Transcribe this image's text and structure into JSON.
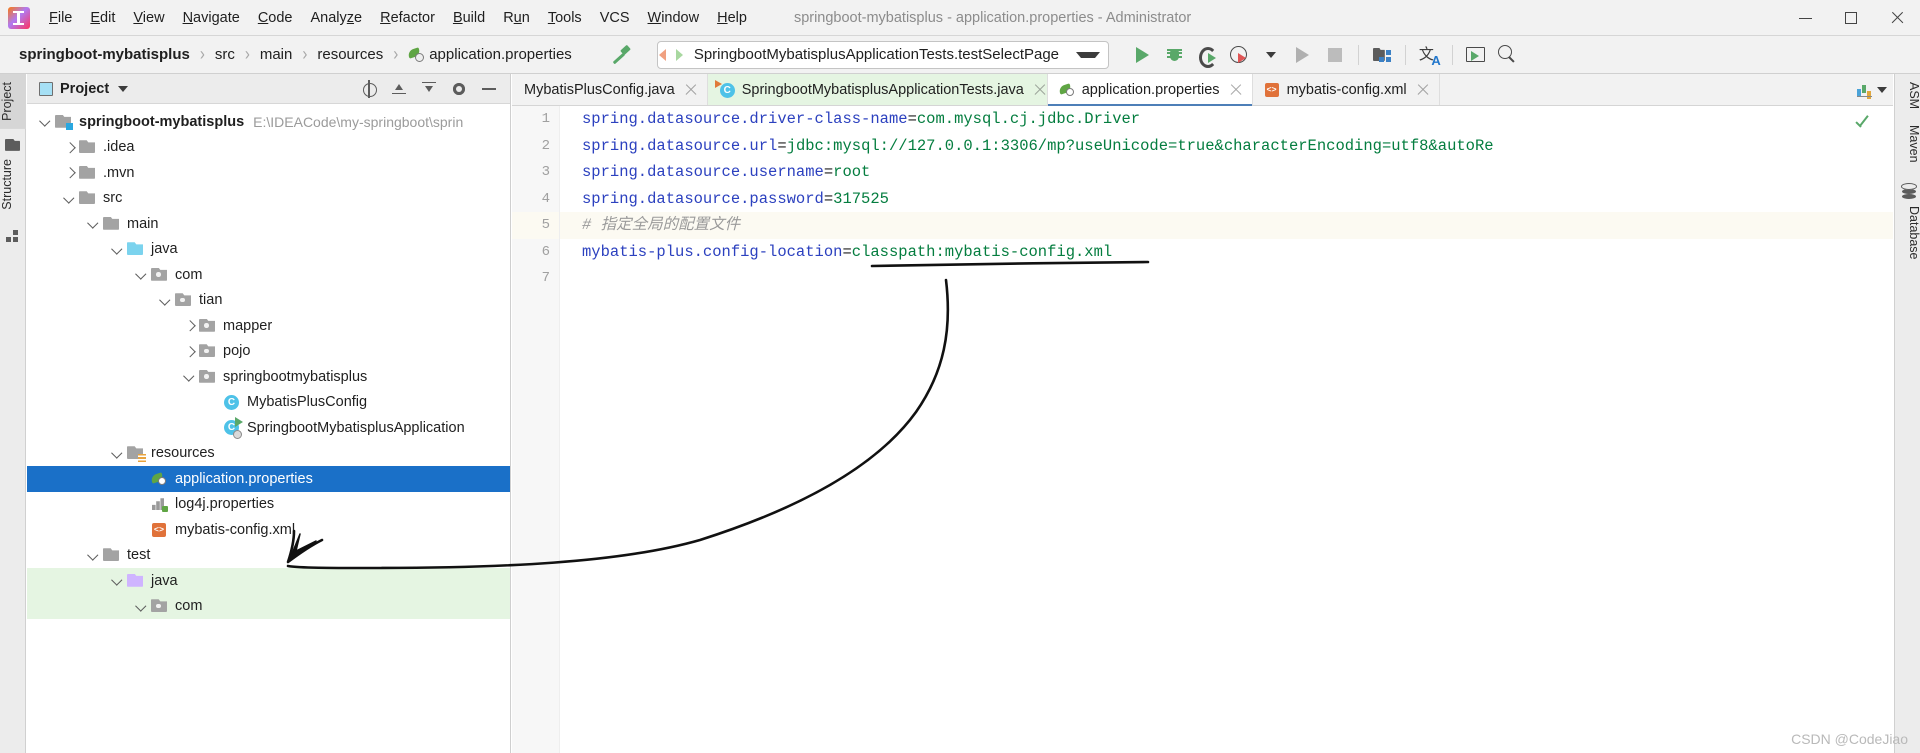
{
  "titlebar": {
    "logo": "intellij-idea-logo",
    "menus": [
      {
        "label": "File",
        "accel": "F"
      },
      {
        "label": "Edit",
        "accel": "E"
      },
      {
        "label": "View",
        "accel": "V"
      },
      {
        "label": "Navigate",
        "accel": "N"
      },
      {
        "label": "Code",
        "accel": "C"
      },
      {
        "label": "Analyze",
        "accel": "z"
      },
      {
        "label": "Refactor",
        "accel": "R"
      },
      {
        "label": "Build",
        "accel": "B"
      },
      {
        "label": "Run",
        "accel": "u"
      },
      {
        "label": "Tools",
        "accel": "T"
      },
      {
        "label": "VCS",
        "accel": ""
      },
      {
        "label": "Window",
        "accel": "W"
      },
      {
        "label": "Help",
        "accel": "H"
      }
    ],
    "window_title": "springboot-mybatisplus - application.properties - Administrator",
    "buttons": {
      "minimize": "minimize",
      "maximize": "maximize",
      "close": "close"
    }
  },
  "navbar": {
    "breadcrumbs": [
      {
        "label": "springboot-mybatisplus",
        "bold": true,
        "icon": ""
      },
      {
        "label": "src",
        "bold": false,
        "icon": ""
      },
      {
        "label": "main",
        "bold": false,
        "icon": ""
      },
      {
        "label": "resources",
        "bold": false,
        "icon": ""
      },
      {
        "label": "application.properties",
        "bold": false,
        "icon": "spring-properties-icon"
      }
    ],
    "separator": "›",
    "build_button": "build-hammer-icon",
    "run_config": {
      "name": "SpringbootMybatisplusApplicationTests.testSelectPage",
      "dropdown": "chevron-down-icon"
    },
    "actions": [
      {
        "name": "run-button",
        "icon": "run-triangle-icon"
      },
      {
        "name": "debug-button",
        "icon": "debug-bug-icon"
      },
      {
        "name": "run-with-coverage-button",
        "icon": "coverage-icon"
      },
      {
        "name": "profile-button",
        "icon": "profiler-icon"
      },
      {
        "name": "profile-dropdown",
        "icon": "chevron-down-icon"
      },
      {
        "name": "rerun-button",
        "icon": "run-triangle-gray-icon"
      },
      {
        "name": "stop-button",
        "icon": "stop-square-icon"
      },
      {
        "name": "project-structure-button",
        "icon": "project-structure-icon"
      },
      {
        "name": "translate-button",
        "icon": "translate-icon"
      },
      {
        "name": "terminal-button",
        "icon": "terminal-icon"
      },
      {
        "name": "search-everywhere-button",
        "icon": "search-icon"
      }
    ]
  },
  "left_rail": {
    "tabs": [
      {
        "label": "Project",
        "active": true
      },
      {
        "label": "Structure",
        "active": false
      }
    ],
    "icons": [
      "folder-icon",
      "structure-dots-icon"
    ]
  },
  "right_rail": {
    "tabs": [
      {
        "label": "ASM",
        "active": false
      },
      {
        "label": "Maven",
        "active": false
      },
      {
        "label": "Database",
        "active": false
      }
    ]
  },
  "project_panel": {
    "title": "Project",
    "title_icon": "project-view-icon",
    "dropdown": "chevron-down-icon",
    "actions": [
      {
        "name": "select-opened-file-button",
        "icon": "locate-icon"
      },
      {
        "name": "expand-all-button",
        "icon": "expand-all-icon"
      },
      {
        "name": "collapse-all-button",
        "icon": "collapse-all-icon"
      },
      {
        "name": "settings-button",
        "icon": "gear-icon"
      },
      {
        "name": "hide-button",
        "icon": "minimize-icon"
      }
    ],
    "tree": [
      {
        "label": "springboot-mybatisplus",
        "path": "E:\\IDEACode\\my-springboot\\sprin",
        "depth": 0,
        "chevron": "open",
        "icon": "module-folder-icon",
        "bold": true,
        "selected": false,
        "testbg": false
      },
      {
        "label": ".idea",
        "path": "",
        "depth": 1,
        "chevron": "closed",
        "icon": "folder-icon",
        "bold": false,
        "selected": false,
        "testbg": false
      },
      {
        "label": ".mvn",
        "path": "",
        "depth": 1,
        "chevron": "closed",
        "icon": "folder-icon",
        "bold": false,
        "selected": false,
        "testbg": false
      },
      {
        "label": "src",
        "path": "",
        "depth": 1,
        "chevron": "open",
        "icon": "folder-icon",
        "bold": false,
        "selected": false,
        "testbg": false
      },
      {
        "label": "main",
        "path": "",
        "depth": 2,
        "chevron": "open",
        "icon": "folder-icon",
        "bold": false,
        "selected": false,
        "testbg": false
      },
      {
        "label": "java",
        "path": "",
        "depth": 3,
        "chevron": "open",
        "icon": "source-root-folder-icon",
        "bold": false,
        "selected": false,
        "testbg": false
      },
      {
        "label": "com",
        "path": "",
        "depth": 4,
        "chevron": "open",
        "icon": "package-icon",
        "bold": false,
        "selected": false,
        "testbg": false
      },
      {
        "label": "tian",
        "path": "",
        "depth": 5,
        "chevron": "open",
        "icon": "package-icon",
        "bold": false,
        "selected": false,
        "testbg": false
      },
      {
        "label": "mapper",
        "path": "",
        "depth": 6,
        "chevron": "closed",
        "icon": "package-icon",
        "bold": false,
        "selected": false,
        "testbg": false
      },
      {
        "label": "pojo",
        "path": "",
        "depth": 6,
        "chevron": "closed",
        "icon": "package-icon",
        "bold": false,
        "selected": false,
        "testbg": false
      },
      {
        "label": "springbootmybatisplus",
        "path": "",
        "depth": 6,
        "chevron": "open",
        "icon": "package-icon",
        "bold": false,
        "selected": false,
        "testbg": false
      },
      {
        "label": "MybatisPlusConfig",
        "path": "",
        "depth": 7,
        "chevron": "none",
        "icon": "java-class-icon",
        "bold": false,
        "selected": false,
        "testbg": false
      },
      {
        "label": "SpringbootMybatisplusApplication",
        "path": "",
        "depth": 7,
        "chevron": "none",
        "icon": "java-runnable-class-icon",
        "bold": false,
        "selected": false,
        "testbg": false
      },
      {
        "label": "resources",
        "path": "",
        "depth": 3,
        "chevron": "open",
        "icon": "resources-root-folder-icon",
        "bold": false,
        "selected": false,
        "testbg": false
      },
      {
        "label": "application.properties",
        "path": "",
        "depth": 4,
        "chevron": "none",
        "icon": "spring-properties-icon",
        "bold": false,
        "selected": true,
        "testbg": false
      },
      {
        "label": "log4j.properties",
        "path": "",
        "depth": 4,
        "chevron": "none",
        "icon": "log4j-properties-icon",
        "bold": false,
        "selected": false,
        "testbg": false
      },
      {
        "label": "mybatis-config.xml",
        "path": "",
        "depth": 4,
        "chevron": "none",
        "icon": "xml-file-icon",
        "bold": false,
        "selected": false,
        "testbg": false
      },
      {
        "label": "test",
        "path": "",
        "depth": 2,
        "chevron": "open",
        "icon": "folder-icon",
        "bold": false,
        "selected": false,
        "testbg": false
      },
      {
        "label": "java",
        "path": "",
        "depth": 3,
        "chevron": "open",
        "icon": "test-source-root-folder-icon",
        "bold": false,
        "selected": false,
        "testbg": true
      },
      {
        "label": "com",
        "path": "",
        "depth": 4,
        "chevron": "open",
        "icon": "package-icon",
        "bold": false,
        "selected": false,
        "testbg": true
      }
    ]
  },
  "editor": {
    "tabs": [
      {
        "label": "MybatisPlusConfig.java",
        "icon": "java-class-icon",
        "state": "normal",
        "closable": true,
        "truncated": true
      },
      {
        "label": "SpringbootMybatisplusApplicationTests.java",
        "icon": "java-test-class-icon",
        "state": "green",
        "closable": true,
        "truncated": false
      },
      {
        "label": "application.properties",
        "icon": "spring-properties-icon",
        "state": "active",
        "closable": true,
        "truncated": false
      },
      {
        "label": "mybatis-config.xml",
        "icon": "xml-file-icon",
        "state": "normal",
        "closable": true,
        "truncated": false
      }
    ],
    "tab_extras": [
      {
        "name": "chart-icon",
        "icon": "chart-icon"
      },
      {
        "name": "tabs-overflow-chevron",
        "icon": "chevron-down-icon"
      }
    ],
    "inspection_status": "ok",
    "lines": [
      {
        "num": "1",
        "highlight": false,
        "tokens": [
          {
            "t": "spring.datasource.driver-class-name",
            "c": "k"
          },
          {
            "t": "=",
            "c": "eq"
          },
          {
            "t": "com.mysql.cj.jdbc.Driver",
            "c": "v"
          }
        ]
      },
      {
        "num": "2",
        "highlight": false,
        "tokens": [
          {
            "t": "spring.datasource.url",
            "c": "k"
          },
          {
            "t": "=",
            "c": "eq"
          },
          {
            "t": "jdbc:mysql://127.0.0.1:3306/mp?useUnicode=true&characterEncoding=utf8&autoRe",
            "c": "v"
          }
        ]
      },
      {
        "num": "3",
        "highlight": false,
        "tokens": [
          {
            "t": "spring.datasource.username",
            "c": "k"
          },
          {
            "t": "=",
            "c": "eq"
          },
          {
            "t": "root",
            "c": "v"
          }
        ]
      },
      {
        "num": "4",
        "highlight": false,
        "tokens": [
          {
            "t": "spring.datasource.password",
            "c": "k"
          },
          {
            "t": "=",
            "c": "eq"
          },
          {
            "t": "317525",
            "c": "v"
          }
        ]
      },
      {
        "num": "5",
        "highlight": true,
        "tokens": [
          {
            "t": "# 指定全局的配置文件",
            "c": "cm"
          }
        ]
      },
      {
        "num": "6",
        "highlight": false,
        "tokens": [
          {
            "t": "mybatis-plus.config-location",
            "c": "k"
          },
          {
            "t": "=",
            "c": "eq"
          },
          {
            "t": "classpath:mybatis-config.xml",
            "c": "v"
          }
        ]
      },
      {
        "num": "7",
        "highlight": false,
        "tokens": []
      }
    ]
  },
  "annotations": {
    "underline": "hand-drawn-underline-under-classpath-value",
    "arrow": "hand-drawn-arrow-from-config-location-to-mybatis-config-xml"
  },
  "watermark": "CSDN @CodeJiao",
  "colors": {
    "accent_blue": "#1a70c8",
    "green": "#59a869",
    "key_blue": "#2c41bf",
    "value_green": "#047d3f",
    "comment_gray": "#9a9a9a",
    "test_bg": "#e5f5e2",
    "chrome_gray": "#f2f2f2"
  }
}
